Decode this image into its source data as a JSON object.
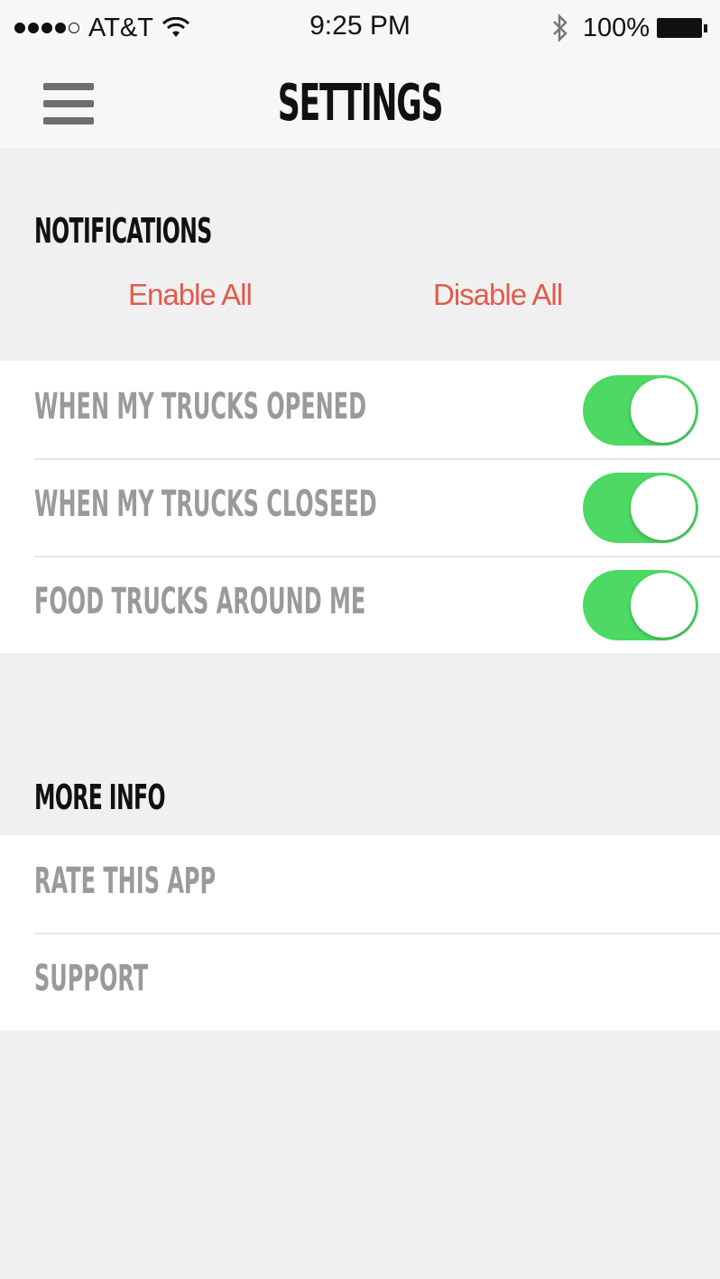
{
  "status_bar": {
    "carrier": "AT&T",
    "time": "9:25 PM",
    "battery": "100%"
  },
  "nav": {
    "title": "SETTINGS"
  },
  "notifications": {
    "header": "NOTIFICATIONS",
    "enable_all": "Enable All",
    "disable_all": "Disable All",
    "items": [
      {
        "label": "WHEN MY TRUCKS OPENED",
        "on": true
      },
      {
        "label": "WHEN MY TRUCKS CLOSEED",
        "on": true
      },
      {
        "label": "FOOD TRUCKS AROUND ME",
        "on": true
      }
    ]
  },
  "more_info": {
    "header": "MORE INFO",
    "items": [
      {
        "label": "RATE THIS APP"
      },
      {
        "label": "SUPPORT"
      }
    ]
  },
  "colors": {
    "accent": "#e15b4c",
    "toggle_on": "#4cd964",
    "background": "#f0f0f0"
  }
}
